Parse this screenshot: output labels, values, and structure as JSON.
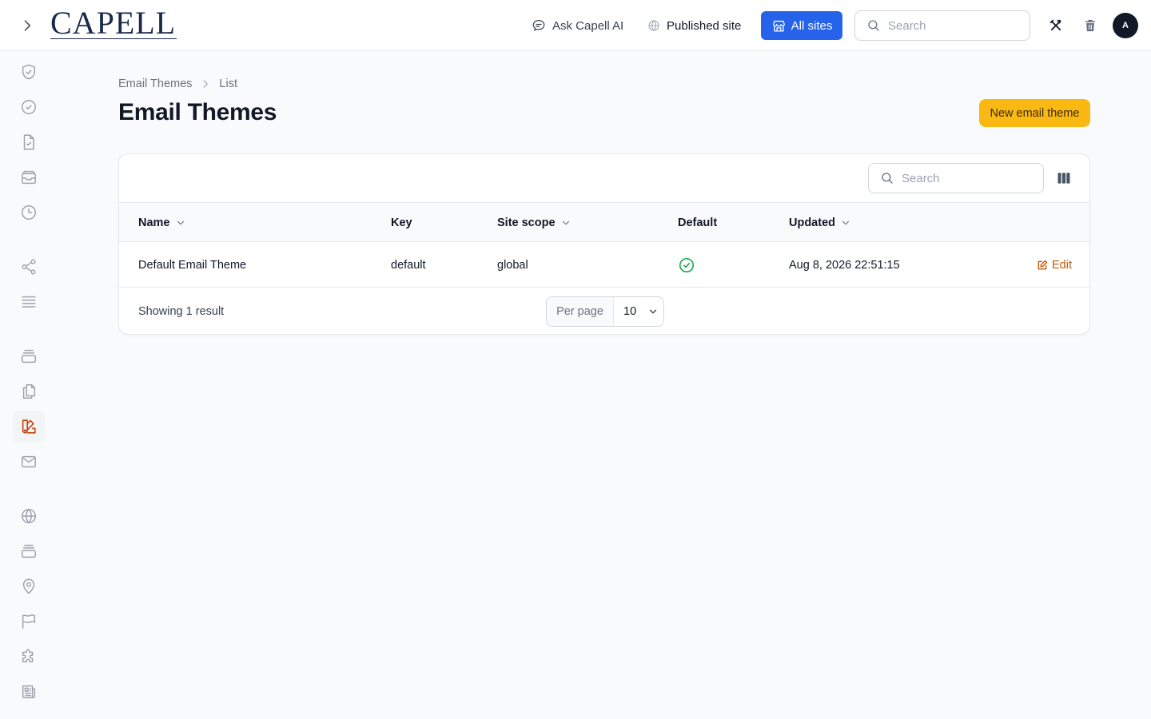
{
  "app": {
    "logo_text": "CAPELL"
  },
  "topbar": {
    "ask_ai_label": "Ask Capell AI",
    "published_site_label": "Published site",
    "all_sites_label": "All sites",
    "search_placeholder": "Search",
    "avatar_initial": "A"
  },
  "colors": {
    "primary": "#2563eb",
    "accent": "#f9b912",
    "edit": "#c25b06",
    "success": "#16a34a",
    "active_nav": "#c2410c"
  },
  "sidebar": {
    "items": [
      {
        "icon": "shield-check-icon",
        "active": false
      },
      {
        "icon": "check-circle-icon",
        "active": false
      },
      {
        "icon": "document-check-icon",
        "active": false
      },
      {
        "icon": "inbox-stack-icon",
        "active": false
      },
      {
        "icon": "clock-icon",
        "active": false
      },
      {
        "icon": "share-icon",
        "active": false
      },
      {
        "icon": "queue-list-icon",
        "active": false
      },
      {
        "icon": "rectangle-stack-icon",
        "active": false
      },
      {
        "icon": "document-duplicate-icon",
        "active": false
      },
      {
        "icon": "swatch-icon",
        "active": true
      },
      {
        "icon": "envelope-icon",
        "active": false
      },
      {
        "icon": "globe-icon",
        "active": false
      },
      {
        "icon": "rectangle-stack-icon",
        "active": false
      },
      {
        "icon": "map-pin-icon",
        "active": false
      },
      {
        "icon": "flag-icon",
        "active": false
      },
      {
        "icon": "puzzle-piece-icon",
        "active": false
      },
      {
        "icon": "newspaper-icon",
        "active": false
      }
    ]
  },
  "breadcrumb": {
    "items": [
      "Email Themes",
      "List"
    ]
  },
  "page": {
    "title": "Email Themes",
    "new_button_label": "New email theme"
  },
  "table": {
    "search_placeholder": "Search",
    "columns": [
      {
        "label": "Name",
        "sortable": true
      },
      {
        "label": "Key",
        "sortable": false
      },
      {
        "label": "Site scope",
        "sortable": true
      },
      {
        "label": "Default",
        "sortable": false
      },
      {
        "label": "Updated",
        "sortable": true
      }
    ],
    "rows": [
      {
        "name": "Default Email Theme",
        "key": "default",
        "site_scope": "global",
        "default": true,
        "updated": "Aug 8, 2026 22:51:15",
        "action_label": "Edit"
      }
    ],
    "result_text": "Showing 1 result",
    "per_page_label": "Per page",
    "per_page_value": "10"
  }
}
